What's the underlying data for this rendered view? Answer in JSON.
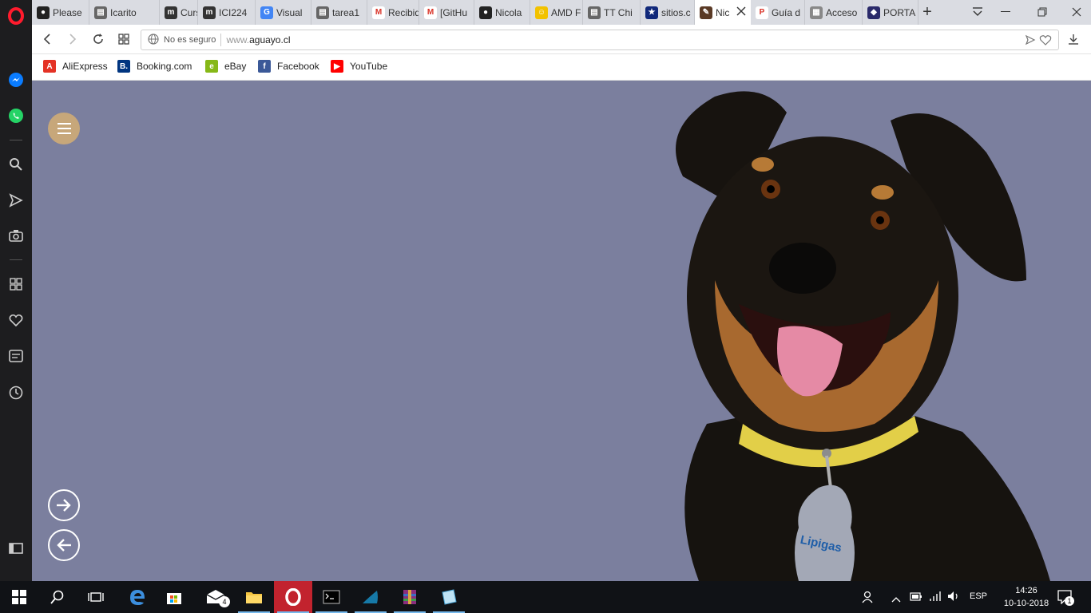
{
  "browser": {
    "tabs": [
      {
        "label": "Please",
        "icon": "github-icon"
      },
      {
        "label": "Icarito",
        "icon": "document-icon"
      },
      {
        "label": "Curso:",
        "icon": "moodle-icon"
      },
      {
        "label": "ICI224",
        "icon": "moodle-icon"
      },
      {
        "label": "Visual",
        "icon": "google-icon"
      },
      {
        "label": "tarea1",
        "icon": "document-icon"
      },
      {
        "label": "Recibid",
        "icon": "gmail-icon"
      },
      {
        "label": "[GitHu",
        "icon": "gmail-icon"
      },
      {
        "label": "Nicola",
        "icon": "github-icon"
      },
      {
        "label": "AMD F",
        "icon": "smiley-icon"
      },
      {
        "label": "TT Chi",
        "icon": "document-icon"
      },
      {
        "label": "sitios.c",
        "icon": "star-icon"
      },
      {
        "label": "Nic",
        "icon": "site-icon",
        "active": true
      },
      {
        "label": "Guía d",
        "icon": "pdf-icon"
      },
      {
        "label": "Acceso",
        "icon": "grid-icon"
      },
      {
        "label": "PORTA",
        "icon": "shield-icon"
      }
    ],
    "new_tab_label": "+",
    "address": {
      "security_label": "No es seguro",
      "url_prefix": "www.",
      "url_domain": "aguayo.cl"
    },
    "bookmarks": [
      {
        "label": "AliExpress",
        "icon": "aliexpress-icon",
        "color": "#e43225"
      },
      {
        "label": "Booking.com",
        "icon": "booking-icon",
        "color": "#003580"
      },
      {
        "label": "eBay",
        "icon": "ebay-icon",
        "color": "#86b817"
      },
      {
        "label": "Facebook",
        "icon": "facebook-icon",
        "color": "#3b5998"
      },
      {
        "label": "YouTube",
        "icon": "youtube-icon",
        "color": "#ff0000"
      }
    ]
  },
  "page": {
    "background_color": "#7b7f9e",
    "accent_color": "#c7a77a",
    "tag_brand": "Lipigas"
  },
  "taskbar": {
    "mail_badge": "4",
    "language": "ESP",
    "time": "14:26",
    "date": "10-10-2018",
    "notification_count": "1"
  }
}
